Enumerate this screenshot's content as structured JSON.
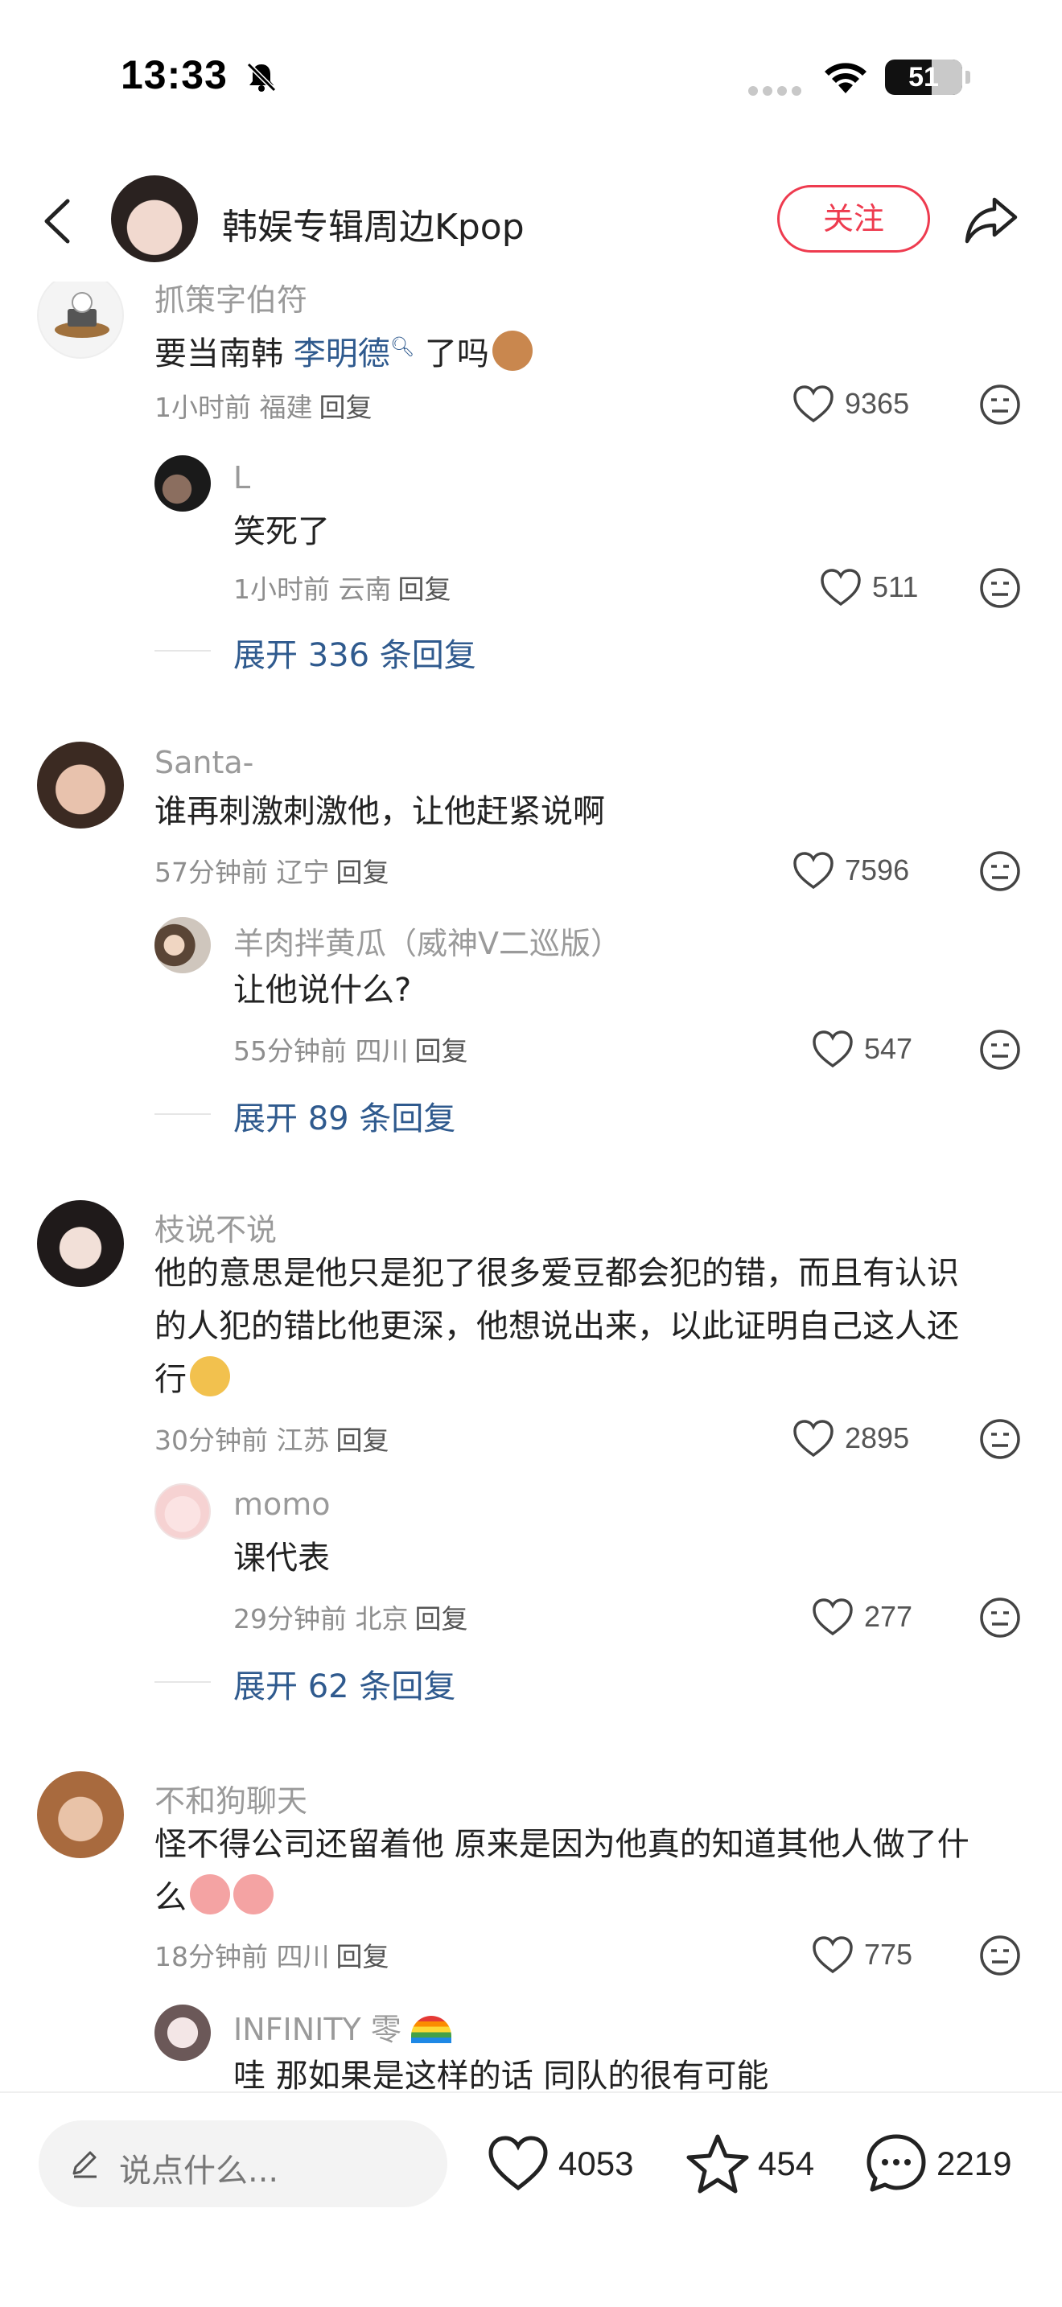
{
  "status_bar": {
    "time": "13:33",
    "battery": "51"
  },
  "header": {
    "title": "韩娱专辑周边Kpop",
    "follow_label": "关注"
  },
  "comments": [
    {
      "username": "抓策字伯符",
      "text_before": "要当南韩 ",
      "mention": "李明德",
      "text_after": " 了吗",
      "meta": "1小时前 福建",
      "reply": "回复",
      "likes": "9365",
      "reply_item": {
        "username": "L",
        "text": "笑死了",
        "meta": "1小时前 云南",
        "reply": "回复",
        "likes": "511"
      },
      "expand": "展开 336 条回复"
    },
    {
      "username": "Santa-",
      "lines": [
        "谁再刺激刺激他，让他赶紧说啊"
      ],
      "meta": "57分钟前 辽宁",
      "reply": "回复",
      "likes": "7596",
      "reply_item": {
        "username": "羊肉拌黄瓜（威神Ⅴ二巡版）",
        "text": "让他说什么?",
        "meta": "55分钟前 四川",
        "reply": "回复",
        "likes": "547"
      },
      "expand": "展开 89 条回复"
    },
    {
      "username": "枝说不说",
      "lines": [
        "他的意思是他只是犯了很多爱豆都会犯的错，而且有认识",
        "的人犯的错比他更深，他想说出来，以此证明自己这人还",
        "行"
      ],
      "meta": "30分钟前 江苏",
      "reply": "回复",
      "likes": "2895",
      "reply_item": {
        "username": "momo",
        "text": "课代表",
        "meta": "29分钟前 北京",
        "reply": "回复",
        "likes": "277"
      },
      "expand": "展开 62 条回复"
    },
    {
      "username": "不和狗聊天",
      "lines": [
        "怪不得公司还留着他 原来是因为他真的知道其他人做了什",
        "么"
      ],
      "meta": "18分钟前 四川",
      "reply": "回复",
      "likes": "775",
      "reply_item": {
        "username": "INFINITY 零",
        "text": "哇 那如果是这样的话 同队的很有可能"
      }
    }
  ],
  "bottom_bar": {
    "input_placeholder": "说点什么...",
    "likes": "4053",
    "favorites": "454",
    "comments": "2219"
  },
  "colors": {
    "accent": "#ee3b4f",
    "link": "#2f5a8e"
  }
}
